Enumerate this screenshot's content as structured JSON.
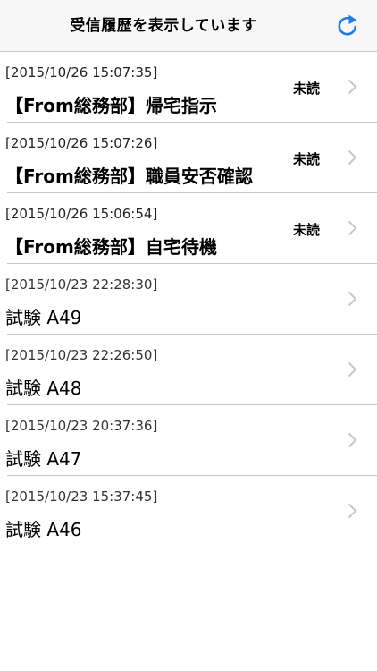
{
  "header": {
    "title": "受信履歴を表示しています",
    "refresh_icon": "refresh-icon",
    "accent_color": "#1f7de0"
  },
  "messages": [
    {
      "datetime": "[2015/10/26 15:07:35]",
      "title": "【From総務部】帰宅指示",
      "status": "未読",
      "unread": true
    },
    {
      "datetime": "[2015/10/26 15:07:26]",
      "title": "【From総務部】職員安否確認",
      "status": "未読",
      "unread": true
    },
    {
      "datetime": "[2015/10/26 15:06:54]",
      "title": "【From総務部】自宅待機",
      "status": "未読",
      "unread": true
    },
    {
      "datetime": "[2015/10/23 22:28:30]",
      "title": "試験 A49",
      "status": "",
      "unread": false
    },
    {
      "datetime": "[2015/10/23 22:26:50]",
      "title": "試験 A48",
      "status": "",
      "unread": false
    },
    {
      "datetime": "[2015/10/23 20:37:36]",
      "title": "試験 A47",
      "status": "",
      "unread": false
    },
    {
      "datetime": "[2015/10/23 15:37:45]",
      "title": "試験 A46",
      "status": "",
      "unread": false
    }
  ]
}
